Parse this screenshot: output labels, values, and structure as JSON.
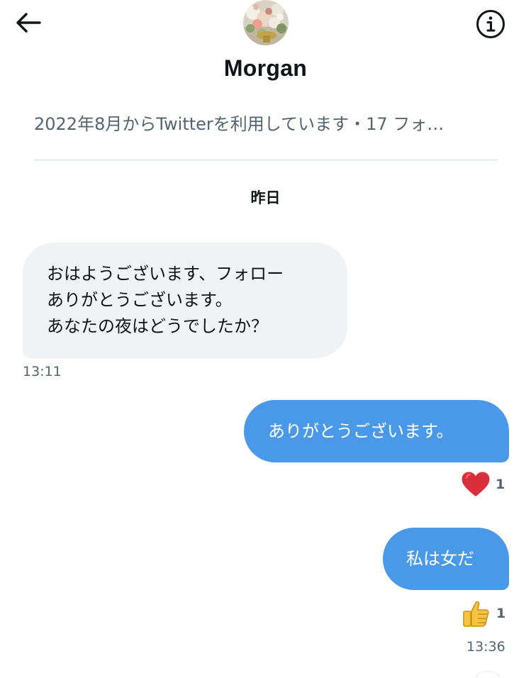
{
  "header": {
    "back_icon": "arrow-left-icon",
    "info_icon": "info-circle-icon",
    "avatar_icon": "floral-photo-avatar",
    "display_name": "Morgan",
    "profile_meta": "2022年8月からTwitterを利用しています・17 フォ…"
  },
  "conversation": {
    "date_separator": "昨日",
    "messages": [
      {
        "direction": "incoming",
        "lines": [
          "おはようございます、フォロー",
          "ありがとうございます。",
          "あなたの夜はどうでしたか？"
        ],
        "time": "13:11"
      },
      {
        "direction": "outgoing",
        "text": "ありがとうございます。",
        "reaction": {
          "icon": "red-heart-icon",
          "count": "1"
        }
      },
      {
        "direction": "outgoing",
        "text": "私は女だ",
        "reaction": {
          "icon": "thumbs-up-icon",
          "count": "1"
        },
        "time": "13:36"
      }
    ]
  },
  "colors": {
    "outgoing_bubble": "#4a99e9",
    "incoming_bubble": "#eff3f4",
    "secondary_text": "#536471",
    "heart": "#d92f3a",
    "divider": "#cfd9de"
  }
}
